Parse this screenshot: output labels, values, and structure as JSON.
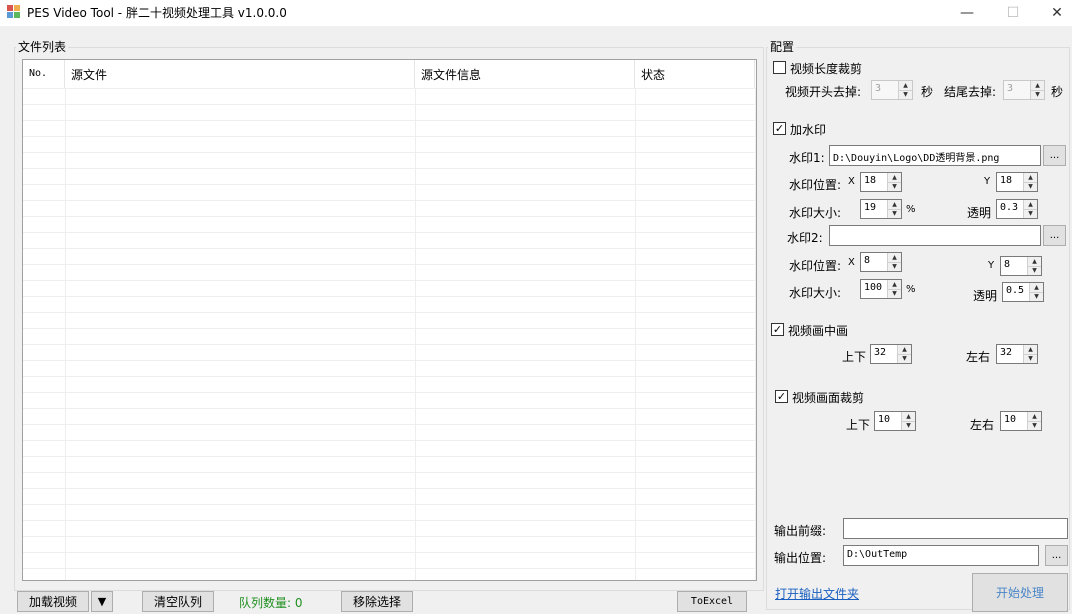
{
  "window": {
    "title": "PES Video Tool - 胖二十视频处理工具 v1.0.0.0",
    "minimize": "—",
    "maximize": "☐",
    "close": "✕"
  },
  "file_list": {
    "group_label": "文件列表",
    "columns": [
      "No.",
      "源文件",
      "源文件信息",
      "状态"
    ]
  },
  "bottom_bar": {
    "load_video": "加载视频",
    "dropdown_arrow": "▼",
    "clear_queue": "清空队列",
    "queue_count": "队列数量: 0",
    "remove_selected": "移除选择",
    "to_excel": "ToExcel"
  },
  "config": {
    "group_label": "配置",
    "trim": {
      "label": "视频长度裁剪",
      "checked": false,
      "check_mark": "",
      "start_label": "视频开头去掉:",
      "start_value": "3",
      "start_unit": "秒",
      "end_label": "结尾去掉:",
      "end_value": "3",
      "end_unit": "秒"
    },
    "watermark": {
      "label": "加水印",
      "checked": true,
      "check_mark": "✓",
      "wm1_label": "水印1:",
      "wm1_path": "D:\\Douyin\\Logo\\DD透明背景.png",
      "wm1_browse": "...",
      "wm1_pos_label": "水印位置:",
      "wm1_x_label": "X",
      "wm1_x": "18",
      "wm1_y_label": "Y",
      "wm1_y": "18",
      "wm1_size_label": "水印大小:",
      "wm1_size": "19",
      "wm1_size_unit": "%",
      "wm1_opacity_label": "透明",
      "wm1_opacity": "0.3",
      "wm2_label": "水印2:",
      "wm2_path": "",
      "wm2_browse": "...",
      "wm2_pos_label": "水印位置:",
      "wm2_x_label": "X",
      "wm2_x": "8",
      "wm2_y_label": "Y",
      "wm2_y": "8",
      "wm2_size_label": "水印大小:",
      "wm2_size": "100",
      "wm2_size_unit": "%",
      "wm2_opacity_label": "透明",
      "wm2_opacity": "0.5"
    },
    "pip": {
      "label": "视频画中画",
      "checked": true,
      "check_mark": "✓",
      "vertical_label": "上下",
      "vertical": "32",
      "horizontal_label": "左右",
      "horizontal": "32"
    },
    "crop": {
      "label": "视频画面裁剪",
      "checked": true,
      "check_mark": "✓",
      "vertical_label": "上下",
      "vertical": "10",
      "horizontal_label": "左右",
      "horizontal": "10"
    },
    "output": {
      "prefix_label": "输出前缀:",
      "prefix_value": "",
      "location_label": "输出位置:",
      "location_value": "D:\\OutTemp",
      "browse": "...",
      "open_folder": "打开输出文件夹",
      "start": "开始处理"
    }
  },
  "colors": {
    "window_bg": "#f0f0f0",
    "queue_count": "#1f8f1f",
    "link": "#1a5fbf"
  },
  "icons": {
    "app": "app-icon",
    "dropdown": "chevron-down-icon"
  }
}
